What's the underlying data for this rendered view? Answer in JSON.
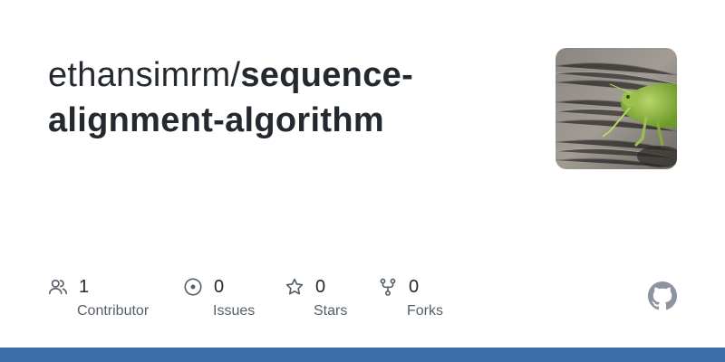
{
  "repo": {
    "owner": "ethansimrm/",
    "name": "sequence-alignment-algorithm"
  },
  "avatar": {
    "description_icon": "grasshopper-avatar-image"
  },
  "stats": [
    {
      "icon": "people-icon",
      "value": "1",
      "label": "Contributor"
    },
    {
      "icon": "issue-icon",
      "value": "0",
      "label": "Issues"
    },
    {
      "icon": "star-icon",
      "value": "0",
      "label": "Stars"
    },
    {
      "icon": "fork-icon",
      "value": "0",
      "label": "Forks"
    }
  ],
  "colors": {
    "text": "#24292f",
    "muted": "#57606a",
    "icon": "#57606a",
    "logo": "#8c959f",
    "bottom_bar": "#3c6ea8"
  }
}
